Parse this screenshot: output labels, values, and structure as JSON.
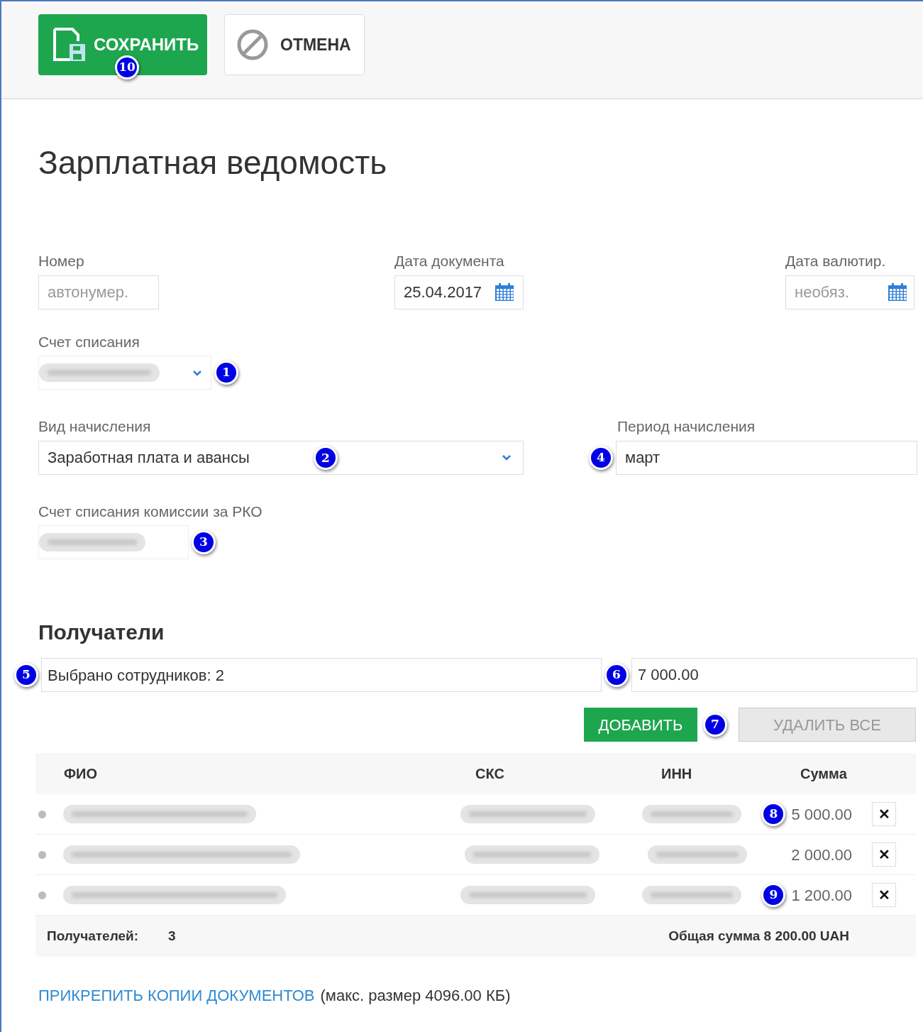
{
  "toolbar": {
    "save": {
      "label": "СОХРАНИТЬ",
      "callout": "10"
    },
    "cancel": {
      "label": "ОТМЕНА"
    }
  },
  "title": "Зарплатная ведомость",
  "number": {
    "label": "Номер",
    "placeholder": "автонумер."
  },
  "doc_date": {
    "label": "Дата документа",
    "value": "25.04.2017"
  },
  "value_date": {
    "label": "Дата валютир.",
    "placeholder": "необяз."
  },
  "debit_account": {
    "label": "Счет списания",
    "callout": "1"
  },
  "accrual_type": {
    "label": "Вид начисления",
    "value": "Заработная плата и авансы",
    "callout": "2"
  },
  "accrual_period": {
    "label": "Период начисления",
    "value": "март",
    "callout": "4"
  },
  "commission_account": {
    "label": "Счет списания комиссии за РКО",
    "callout": "3"
  },
  "recipients": {
    "heading": "Получатели",
    "employees": {
      "value": "Выбрано сотрудников: 2",
      "callout": "5"
    },
    "amount": {
      "value": "7 000.00",
      "callout": "6"
    },
    "add_button": {
      "label": "ДОБАВИТЬ",
      "callout": "7",
      "disabled": false
    },
    "delete_all_button": {
      "label": "УДАЛИТЬ ВСЕ",
      "disabled": true
    },
    "columns": [
      "ФИО",
      "СКС",
      "ИНН",
      "Сумма"
    ],
    "rows": [
      {
        "amount": "5 000.00",
        "callout": "8",
        "remove": "✕"
      },
      {
        "amount": "2 000.00",
        "remove": "✕"
      },
      {
        "amount": "1 200.00",
        "callout": "9",
        "remove": "✕"
      }
    ],
    "footer": {
      "count_label": "Получателей:",
      "count": "3",
      "total": "Общая сумма 8 200.00 UAH"
    }
  },
  "attach": {
    "link": "ПРИКРЕПИТЬ КОПИИ ДОКУМЕНТОВ",
    "note": "(макс. размер 4096.00 КБ)"
  }
}
